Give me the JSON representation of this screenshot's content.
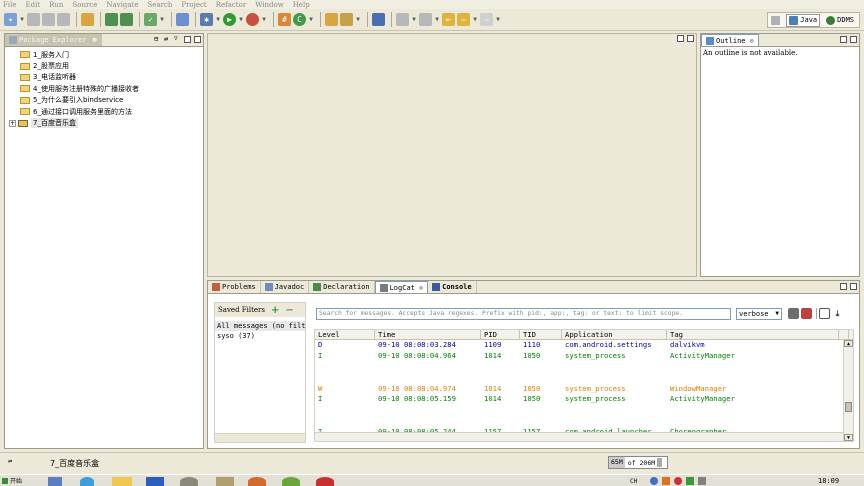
{
  "menubar": [
    "File",
    "Edit",
    "Run",
    "Source",
    "Navigate",
    "Search",
    "Project",
    "Refactor",
    "Window",
    "Help"
  ],
  "perspectives": [
    {
      "label": "Java",
      "icon": "java-perspective-icon",
      "active": true
    },
    {
      "label": "DDMS",
      "icon": "ddms-perspective-icon",
      "active": false
    }
  ],
  "package_explorer": {
    "title": "Package Explorer",
    "items": [
      {
        "label": "1_服务入门",
        "type": "folder"
      },
      {
        "label": "2_股票应用",
        "type": "folder"
      },
      {
        "label": "3_电话监听器",
        "type": "folder"
      },
      {
        "label": "4_使用服务注册特殊的广播接收者",
        "type": "folder"
      },
      {
        "label": "5_为什么要引入bindservice",
        "type": "folder"
      },
      {
        "label": "6_通过接口调用服务里面的方法",
        "type": "folder"
      },
      {
        "label": "7_百度音乐盒",
        "type": "project"
      }
    ]
  },
  "outline": {
    "title": "Outline",
    "message": "An outline is not available."
  },
  "bottom_tabs": [
    {
      "label": "Problems"
    },
    {
      "label": "Javadoc"
    },
    {
      "label": "Declaration"
    },
    {
      "label": "LogCat"
    },
    {
      "label": "Console"
    }
  ],
  "logcat": {
    "saved_filters_label": "Saved Filters",
    "filters": [
      "All messages (no filt",
      "syso (37)"
    ],
    "search_placeholder": "Search for messages. Accepts Java regexes. Prefix with pid:, app:, tag: or text: to limit scope.",
    "level_select": "verbose",
    "columns": [
      "Level",
      "Time",
      "PID",
      "TID",
      "Application",
      "Tag"
    ],
    "rows": [
      {
        "level": "D",
        "time": "09-10 08:08:03.284",
        "pid": "1109",
        "tid": "1110",
        "app": "com.android.settings",
        "tag": "dalvikvm",
        "gap": 0
      },
      {
        "level": "I",
        "time": "09-10 08:08:04.964",
        "pid": "1014",
        "tid": "1050",
        "app": "system_process",
        "tag": "ActivityManager",
        "gap": 0
      },
      {
        "level": "W",
        "time": "09-10 08:08:04.974",
        "pid": "1014",
        "tid": "1050",
        "app": "system_process",
        "tag": "WindowManager",
        "gap": 2
      },
      {
        "level": "I",
        "time": "09-10 08:08:05.159",
        "pid": "1014",
        "tid": "1050",
        "app": "system_process",
        "tag": "ActivityManager",
        "gap": 0
      },
      {
        "level": "I",
        "time": "09-10 08:08:05.244",
        "pid": "1157",
        "tid": "1157",
        "app": "com.android.launcher",
        "tag": "Choreographer",
        "gap": 2
      }
    ]
  },
  "statusbar": {
    "selected": "7_百度音乐盒",
    "heap_used": "65M",
    "heap_of": "of 206M"
  },
  "taskbar": {
    "start": "开始",
    "clock": "18:09",
    "tray_text": "CH"
  },
  "colors": {
    "accent": "#316ac5",
    "logcat_debug": "#0000a0",
    "logcat_info": "#007f00",
    "logcat_warn": "#e67e00"
  }
}
